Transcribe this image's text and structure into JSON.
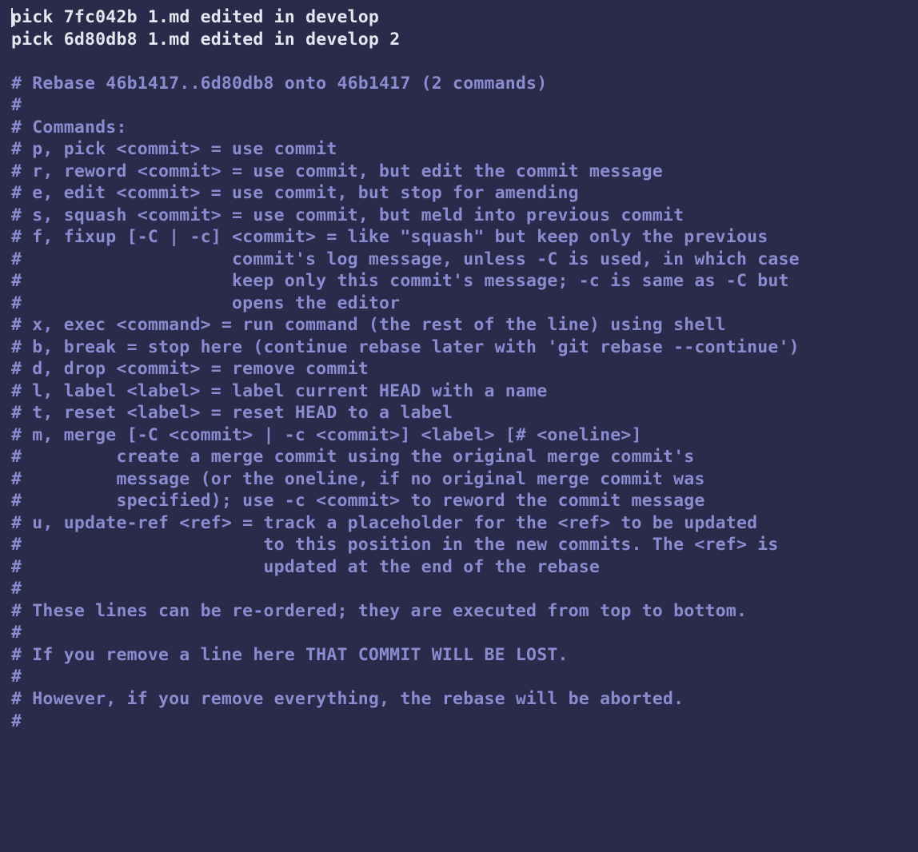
{
  "picks": [
    {
      "cmd": "pick",
      "hash": "7fc042b",
      "msg": "1.md edited in develop"
    },
    {
      "cmd": "pick",
      "hash": "6d80db8",
      "msg": "1.md edited in develop 2"
    }
  ],
  "comment_lines": [
    "",
    "# Rebase 46b1417..6d80db8 onto 46b1417 (2 commands)",
    "#",
    "# Commands:",
    "# p, pick <commit> = use commit",
    "# r, reword <commit> = use commit, but edit the commit message",
    "# e, edit <commit> = use commit, but stop for amending",
    "# s, squash <commit> = use commit, but meld into previous commit",
    "# f, fixup [-C | -c] <commit> = like \"squash\" but keep only the previous",
    "#                    commit's log message, unless -C is used, in which case",
    "#                    keep only this commit's message; -c is same as -C but",
    "#                    opens the editor",
    "# x, exec <command> = run command (the rest of the line) using shell",
    "# b, break = stop here (continue rebase later with 'git rebase --continue')",
    "# d, drop <commit> = remove commit",
    "# l, label <label> = label current HEAD with a name",
    "# t, reset <label> = reset HEAD to a label",
    "# m, merge [-C <commit> | -c <commit>] <label> [# <oneline>]",
    "#         create a merge commit using the original merge commit's",
    "#         message (or the oneline, if no original merge commit was",
    "#         specified); use -c <commit> to reword the commit message",
    "# u, update-ref <ref> = track a placeholder for the <ref> to be updated",
    "#                       to this position in the new commits. The <ref> is",
    "#                       updated at the end of the rebase",
    "#",
    "# These lines can be re-ordered; they are executed from top to bottom.",
    "#",
    "# If you remove a line here THAT COMMIT WILL BE LOST.",
    "#",
    "# However, if you remove everything, the rebase will be aborted.",
    "#"
  ]
}
